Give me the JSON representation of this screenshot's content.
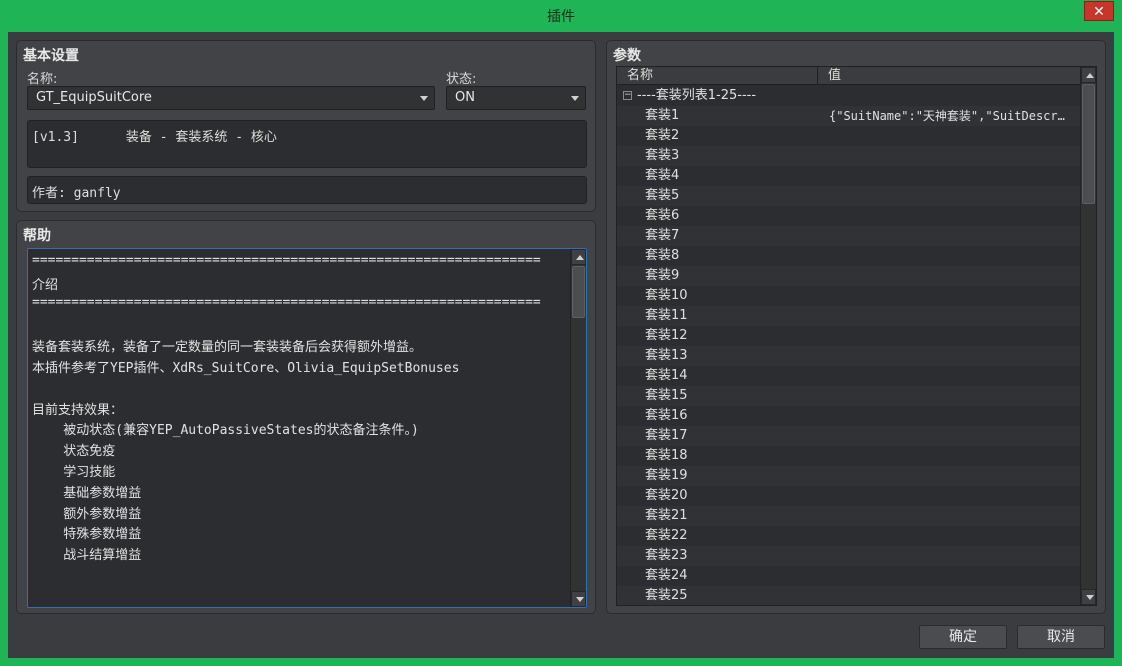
{
  "window": {
    "title": "插件",
    "close_glyph": "✕"
  },
  "basic": {
    "title": "基本设置",
    "name_label": "名称:",
    "name_value": "GT_EquipSuitCore",
    "status_label": "状态:",
    "status_value": "ON",
    "description": "[v1.3]      装备 - 套装系统 - 核心",
    "author": "作者: ganfly"
  },
  "help": {
    "title": "帮助",
    "lines": [
      "=================================================================",
      "介绍",
      "=================================================================",
      "",
      "装备套装系统，装备了一定数量的同一套装装备后会获得额外增益。",
      "本插件参考了YEP插件、XdRs_SuitCore、Olivia_EquipSetBonuses",
      "",
      "目前支持效果：",
      "    被动状态(兼容YEP_AutoPassiveStates的状态备注条件。)",
      "    状态免疫",
      "    学习技能",
      "    基础参数增益",
      "    额外参数增益",
      "    特殊参数增益",
      "    战斗结算增益",
      "",
      "",
      "================================================================="
    ]
  },
  "params": {
    "title": "参数",
    "col_name": "名称",
    "col_value": "值",
    "group_label": "----套装列表1-25----",
    "collapse_glyph": "−",
    "rows": [
      {
        "name": "套装1",
        "value": "{\"SuitName\":\"天神套装\",\"SuitDescr…"
      },
      {
        "name": "套装2",
        "value": ""
      },
      {
        "name": "套装3",
        "value": ""
      },
      {
        "name": "套装4",
        "value": ""
      },
      {
        "name": "套装5",
        "value": ""
      },
      {
        "name": "套装6",
        "value": ""
      },
      {
        "name": "套装7",
        "value": ""
      },
      {
        "name": "套装8",
        "value": ""
      },
      {
        "name": "套装9",
        "value": ""
      },
      {
        "name": "套装10",
        "value": ""
      },
      {
        "name": "套装11",
        "value": ""
      },
      {
        "name": "套装12",
        "value": ""
      },
      {
        "name": "套装13",
        "value": ""
      },
      {
        "name": "套装14",
        "value": ""
      },
      {
        "name": "套装15",
        "value": ""
      },
      {
        "name": "套装16",
        "value": ""
      },
      {
        "name": "套装17",
        "value": ""
      },
      {
        "name": "套装18",
        "value": ""
      },
      {
        "name": "套装19",
        "value": ""
      },
      {
        "name": "套装20",
        "value": ""
      },
      {
        "name": "套装21",
        "value": ""
      },
      {
        "name": "套装22",
        "value": ""
      },
      {
        "name": "套装23",
        "value": ""
      },
      {
        "name": "套装24",
        "value": ""
      },
      {
        "name": "套装25",
        "value": ""
      }
    ]
  },
  "footer": {
    "ok_label": "确定",
    "cancel_label": "取消"
  },
  "colors": {
    "frame": "#1fb455",
    "close": "#c8352b",
    "panel": "#414346",
    "field": "#2b2d30",
    "focus_border": "#3a6bb0"
  }
}
